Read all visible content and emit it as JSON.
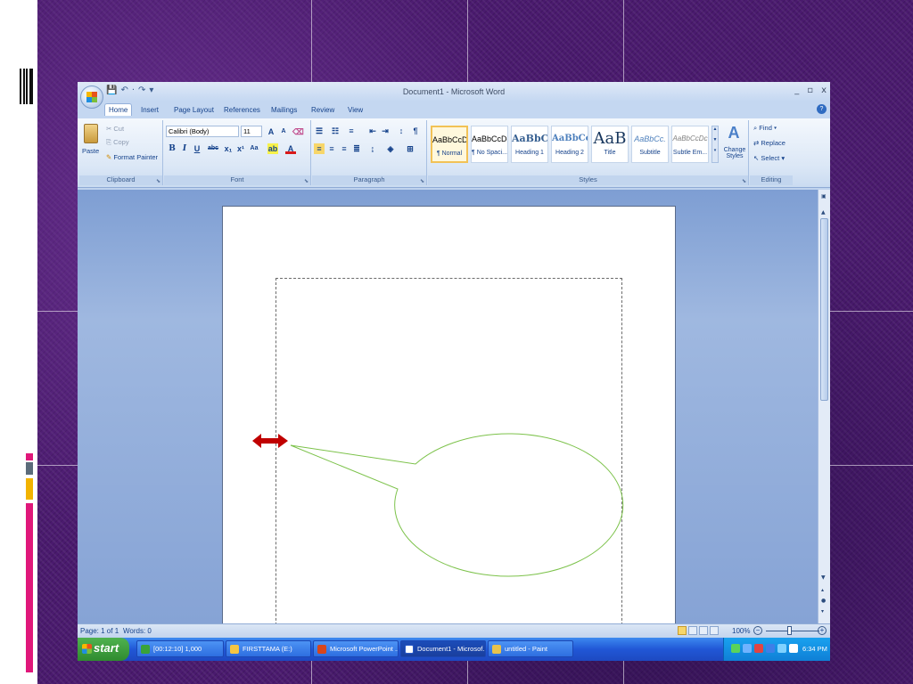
{
  "window": {
    "title": "Document1 - Microsoft Word",
    "controls": [
      "_",
      "▫",
      "x"
    ]
  },
  "quick_access": [
    "💾",
    "↶",
    "·",
    "↷",
    "▾"
  ],
  "tabs": [
    "Home",
    "Insert",
    "Page Layout",
    "References",
    "Mailings",
    "Review",
    "View"
  ],
  "ribbon": {
    "clipboard": {
      "label": "Clipboard",
      "paste": "Paste",
      "cut": "Cut",
      "copy": "Copy",
      "format_painter": "Format Painter"
    },
    "font": {
      "label": "Font",
      "font_name": "Calibri (Body)",
      "font_size": "11"
    },
    "paragraph": {
      "label": "Paragraph"
    },
    "styles": {
      "label": "Styles",
      "cards": [
        {
          "sample": "AaBbCcDc",
          "name": "¶ Normal"
        },
        {
          "sample": "AaBbCcDc",
          "name": "¶ No Spaci..."
        },
        {
          "sample": "AaBbC(",
          "name": "Heading 1"
        },
        {
          "sample": "AaBbCc",
          "name": "Heading 2"
        },
        {
          "sample": "AaB",
          "name": "Title"
        },
        {
          "sample": "AaBbCc.",
          "name": "Subtitle"
        },
        {
          "sample": "AaBbCcDc",
          "name": "Subtle Em..."
        }
      ],
      "change_styles": "Change Styles"
    },
    "editing": {
      "label": "Editing",
      "find": "Find",
      "replace": "Replace",
      "select": "Select"
    }
  },
  "status": {
    "page": "Page: 1 of 1",
    "words": "Words: 0",
    "zoom": "100%"
  },
  "taskbar": {
    "start": "start",
    "items": [
      "[00:12:10] 1,000",
      "FIRSTTAMA (E:)",
      "Microsoft PowerPoint ...",
      "Document1 - Microsof...",
      "untitled - Paint"
    ],
    "clock": "6:34 PM"
  },
  "colors": {
    "accent": "#15428b",
    "callout_stroke": "#7cc24a",
    "arrow": "#c00000"
  }
}
